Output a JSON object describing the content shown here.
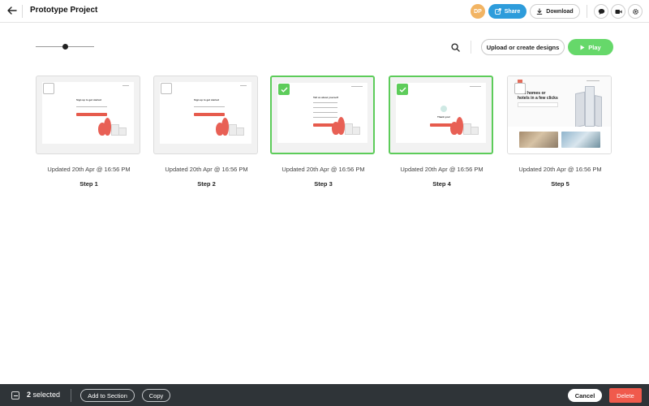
{
  "header": {
    "title": "Prototype Project",
    "avatar_initials": "DP",
    "share_label": "Share",
    "download_label": "Download",
    "back_icon": "arrow-left-icon",
    "comment_icon": "chat-bubble-icon",
    "video_icon": "video-camera-icon",
    "settings_icon": "gear-icon"
  },
  "toolbar": {
    "zoom_level": 0.5,
    "upload_label": "Upload or create designs",
    "play_label": "Play"
  },
  "screens": [
    {
      "name": "Step 1",
      "updated": "Updated 20th Apr @ 16:56 PM",
      "selected": false,
      "thumb_title": "Sign up to get started"
    },
    {
      "name": "Step 2",
      "updated": "Updated 20th Apr @ 16:56 PM",
      "selected": false,
      "thumb_title": "Sign up to get started"
    },
    {
      "name": "Step 3",
      "updated": "Updated 20th Apr @ 16:56 PM",
      "selected": true,
      "thumb_title": "Tell us about yourself"
    },
    {
      "name": "Step 4",
      "updated": "Updated 20th Apr @ 16:56 PM",
      "selected": true,
      "thumb_title": "Thank you!"
    },
    {
      "name": "Step 5",
      "updated": "Updated 20th Apr @ 16:56 PM",
      "selected": false,
      "thumb_title": "Find homes or hotels in a few clicks"
    }
  ],
  "bottom_bar": {
    "selected_count": "2",
    "selected_suffix": "selected",
    "add_to_section_label": "Add to Section",
    "copy_label": "Copy",
    "cancel_label": "Cancel",
    "delete_label": "Delete"
  },
  "colors": {
    "share": "#2d9cdb",
    "play": "#66d86a",
    "selected_border": "#5dcc5a",
    "delete": "#f05a4c",
    "bottom_bar": "#2f3438",
    "avatar": "#f2b463"
  }
}
